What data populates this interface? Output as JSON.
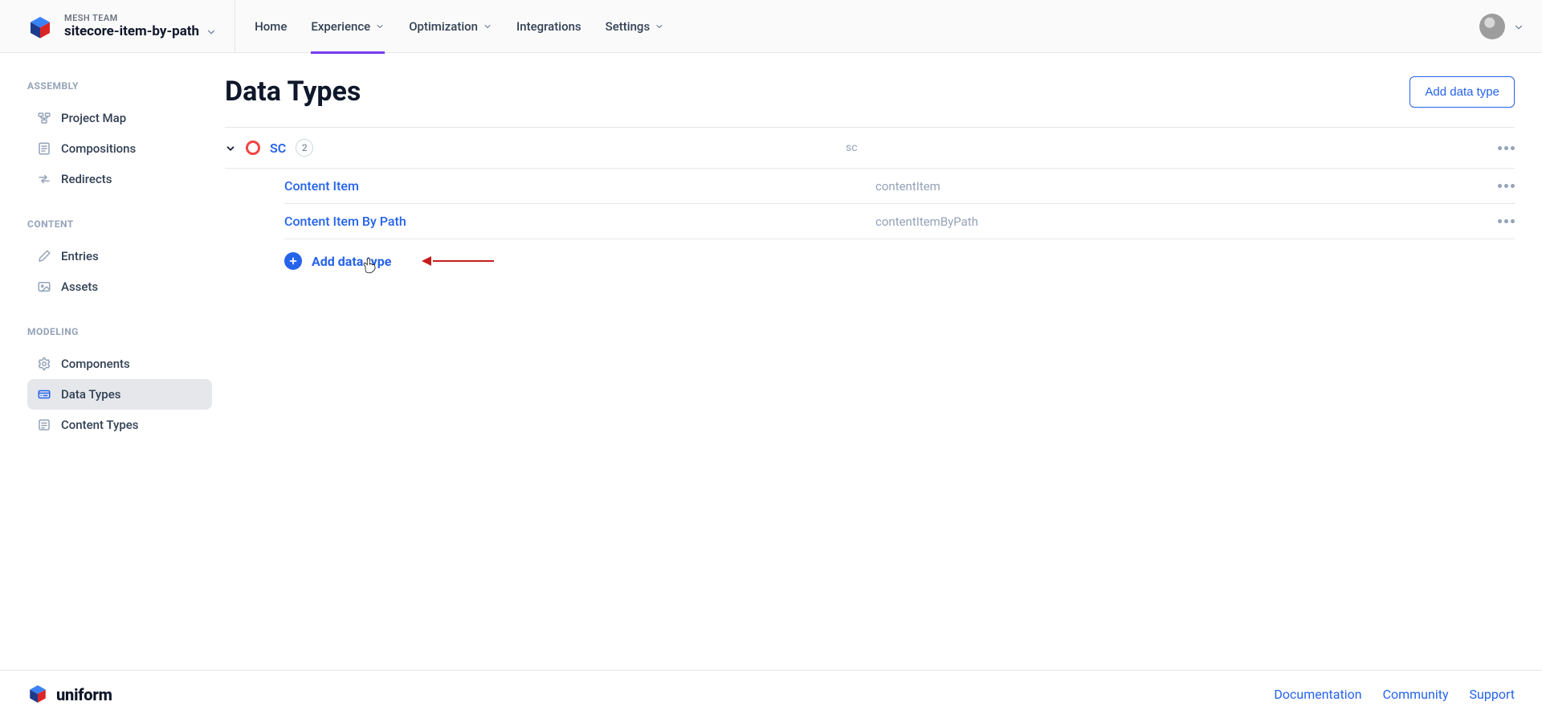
{
  "header": {
    "team_label": "MESH TEAM",
    "project_name": "sitecore-item-by-path",
    "nav": [
      {
        "label": "Home",
        "has_chevron": false,
        "active": false
      },
      {
        "label": "Experience",
        "has_chevron": true,
        "active": true
      },
      {
        "label": "Optimization",
        "has_chevron": true,
        "active": false
      },
      {
        "label": "Integrations",
        "has_chevron": false,
        "active": false
      },
      {
        "label": "Settings",
        "has_chevron": true,
        "active": false
      }
    ]
  },
  "sidebar": {
    "sections": [
      {
        "title": "ASSEMBLY",
        "items": [
          {
            "label": "Project Map",
            "icon": "project-map-icon",
            "active": false
          },
          {
            "label": "Compositions",
            "icon": "compositions-icon",
            "active": false
          },
          {
            "label": "Redirects",
            "icon": "redirects-icon",
            "active": false
          }
        ]
      },
      {
        "title": "CONTENT",
        "items": [
          {
            "label": "Entries",
            "icon": "entries-icon",
            "active": false
          },
          {
            "label": "Assets",
            "icon": "assets-icon",
            "active": false
          }
        ]
      },
      {
        "title": "MODELING",
        "items": [
          {
            "label": "Components",
            "icon": "components-icon",
            "active": false
          },
          {
            "label": "Data Types",
            "icon": "data-types-icon",
            "active": true
          },
          {
            "label": "Content Types",
            "icon": "content-types-icon",
            "active": false
          }
        ]
      }
    ]
  },
  "main": {
    "title": "Data Types",
    "add_button_label": "Add data type",
    "group": {
      "name": "SC",
      "count": "2",
      "id": "sc",
      "items": [
        {
          "name": "Content Item",
          "id": "contentItem"
        },
        {
          "name": "Content Item By Path",
          "id": "contentItemByPath"
        }
      ],
      "add_inline_label": "Add data type"
    }
  },
  "footer": {
    "brand": "uniform",
    "links": [
      {
        "label": "Documentation"
      },
      {
        "label": "Community"
      },
      {
        "label": "Support"
      }
    ]
  }
}
